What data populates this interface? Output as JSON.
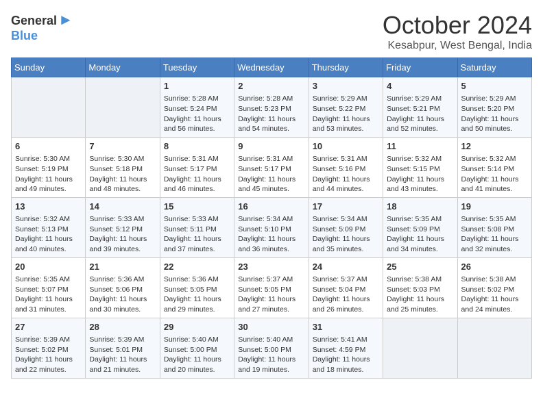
{
  "header": {
    "logo_line1": "General",
    "logo_line2": "Blue",
    "month": "October 2024",
    "location": "Kesabpur, West Bengal, India"
  },
  "weekdays": [
    "Sunday",
    "Monday",
    "Tuesday",
    "Wednesday",
    "Thursday",
    "Friday",
    "Saturday"
  ],
  "weeks": [
    [
      {
        "day": "",
        "info": ""
      },
      {
        "day": "",
        "info": ""
      },
      {
        "day": "1",
        "info": "Sunrise: 5:28 AM\nSunset: 5:24 PM\nDaylight: 11 hours and 56 minutes."
      },
      {
        "day": "2",
        "info": "Sunrise: 5:28 AM\nSunset: 5:23 PM\nDaylight: 11 hours and 54 minutes."
      },
      {
        "day": "3",
        "info": "Sunrise: 5:29 AM\nSunset: 5:22 PM\nDaylight: 11 hours and 53 minutes."
      },
      {
        "day": "4",
        "info": "Sunrise: 5:29 AM\nSunset: 5:21 PM\nDaylight: 11 hours and 52 minutes."
      },
      {
        "day": "5",
        "info": "Sunrise: 5:29 AM\nSunset: 5:20 PM\nDaylight: 11 hours and 50 minutes."
      }
    ],
    [
      {
        "day": "6",
        "info": "Sunrise: 5:30 AM\nSunset: 5:19 PM\nDaylight: 11 hours and 49 minutes."
      },
      {
        "day": "7",
        "info": "Sunrise: 5:30 AM\nSunset: 5:18 PM\nDaylight: 11 hours and 48 minutes."
      },
      {
        "day": "8",
        "info": "Sunrise: 5:31 AM\nSunset: 5:17 PM\nDaylight: 11 hours and 46 minutes."
      },
      {
        "day": "9",
        "info": "Sunrise: 5:31 AM\nSunset: 5:17 PM\nDaylight: 11 hours and 45 minutes."
      },
      {
        "day": "10",
        "info": "Sunrise: 5:31 AM\nSunset: 5:16 PM\nDaylight: 11 hours and 44 minutes."
      },
      {
        "day": "11",
        "info": "Sunrise: 5:32 AM\nSunset: 5:15 PM\nDaylight: 11 hours and 43 minutes."
      },
      {
        "day": "12",
        "info": "Sunrise: 5:32 AM\nSunset: 5:14 PM\nDaylight: 11 hours and 41 minutes."
      }
    ],
    [
      {
        "day": "13",
        "info": "Sunrise: 5:32 AM\nSunset: 5:13 PM\nDaylight: 11 hours and 40 minutes."
      },
      {
        "day": "14",
        "info": "Sunrise: 5:33 AM\nSunset: 5:12 PM\nDaylight: 11 hours and 39 minutes."
      },
      {
        "day": "15",
        "info": "Sunrise: 5:33 AM\nSunset: 5:11 PM\nDaylight: 11 hours and 37 minutes."
      },
      {
        "day": "16",
        "info": "Sunrise: 5:34 AM\nSunset: 5:10 PM\nDaylight: 11 hours and 36 minutes."
      },
      {
        "day": "17",
        "info": "Sunrise: 5:34 AM\nSunset: 5:09 PM\nDaylight: 11 hours and 35 minutes."
      },
      {
        "day": "18",
        "info": "Sunrise: 5:35 AM\nSunset: 5:09 PM\nDaylight: 11 hours and 34 minutes."
      },
      {
        "day": "19",
        "info": "Sunrise: 5:35 AM\nSunset: 5:08 PM\nDaylight: 11 hours and 32 minutes."
      }
    ],
    [
      {
        "day": "20",
        "info": "Sunrise: 5:35 AM\nSunset: 5:07 PM\nDaylight: 11 hours and 31 minutes."
      },
      {
        "day": "21",
        "info": "Sunrise: 5:36 AM\nSunset: 5:06 PM\nDaylight: 11 hours and 30 minutes."
      },
      {
        "day": "22",
        "info": "Sunrise: 5:36 AM\nSunset: 5:05 PM\nDaylight: 11 hours and 29 minutes."
      },
      {
        "day": "23",
        "info": "Sunrise: 5:37 AM\nSunset: 5:05 PM\nDaylight: 11 hours and 27 minutes."
      },
      {
        "day": "24",
        "info": "Sunrise: 5:37 AM\nSunset: 5:04 PM\nDaylight: 11 hours and 26 minutes."
      },
      {
        "day": "25",
        "info": "Sunrise: 5:38 AM\nSunset: 5:03 PM\nDaylight: 11 hours and 25 minutes."
      },
      {
        "day": "26",
        "info": "Sunrise: 5:38 AM\nSunset: 5:02 PM\nDaylight: 11 hours and 24 minutes."
      }
    ],
    [
      {
        "day": "27",
        "info": "Sunrise: 5:39 AM\nSunset: 5:02 PM\nDaylight: 11 hours and 22 minutes."
      },
      {
        "day": "28",
        "info": "Sunrise: 5:39 AM\nSunset: 5:01 PM\nDaylight: 11 hours and 21 minutes."
      },
      {
        "day": "29",
        "info": "Sunrise: 5:40 AM\nSunset: 5:00 PM\nDaylight: 11 hours and 20 minutes."
      },
      {
        "day": "30",
        "info": "Sunrise: 5:40 AM\nSunset: 5:00 PM\nDaylight: 11 hours and 19 minutes."
      },
      {
        "day": "31",
        "info": "Sunrise: 5:41 AM\nSunset: 4:59 PM\nDaylight: 11 hours and 18 minutes."
      },
      {
        "day": "",
        "info": ""
      },
      {
        "day": "",
        "info": ""
      }
    ]
  ]
}
